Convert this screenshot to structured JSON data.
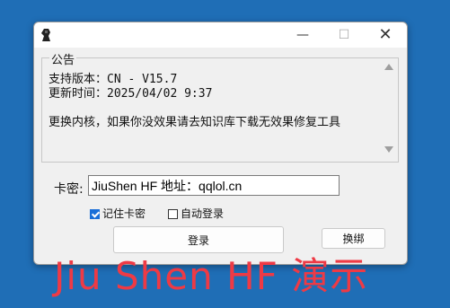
{
  "window": {
    "minimize": "—",
    "maximize": "☐",
    "close": "✕"
  },
  "notice": {
    "legend": "公告",
    "text": "支持版本：CN - V15.7\n更新时间：2025/04/02 9:37\n\n更换内核，如果你没效果请去知识库下载无效果修复工具"
  },
  "form": {
    "cardkey_label": "卡密:",
    "cardkey_value": "JiuShen HF  地址：qqlol.cn",
    "remember_label": "记住卡密",
    "remember_checked": true,
    "autologin_label": "自动登录",
    "autologin_checked": false,
    "login_button": "登录",
    "bind_button": "换绑"
  },
  "overlay": {
    "watermark": "Jiu Shen HF 演示"
  }
}
